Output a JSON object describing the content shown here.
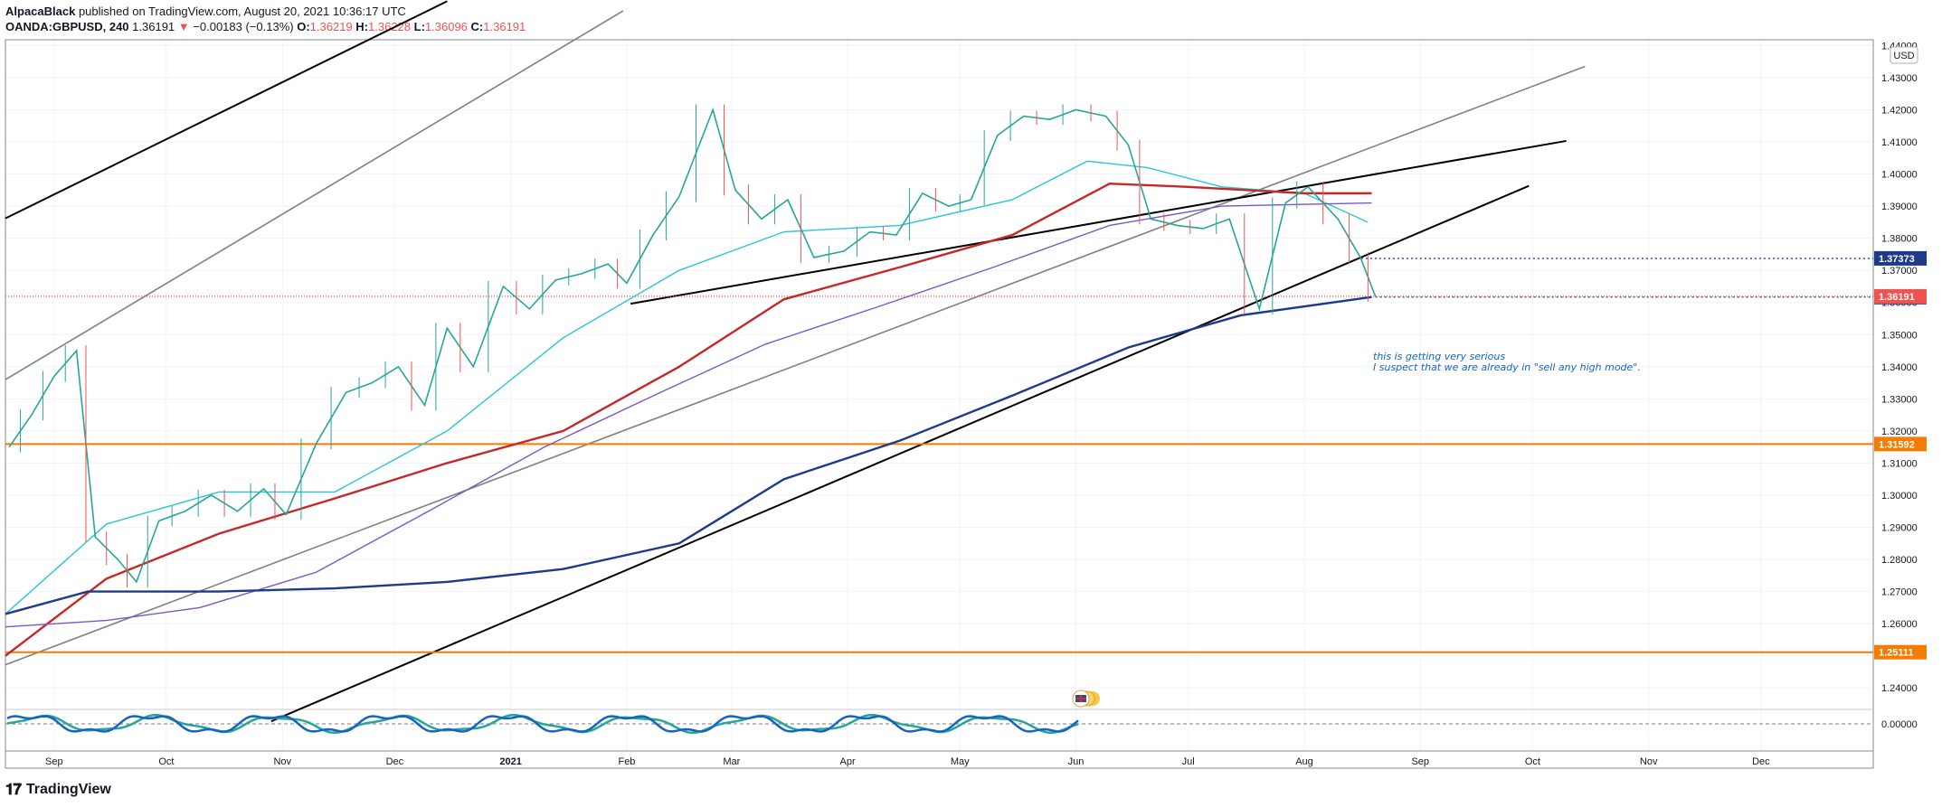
{
  "header": {
    "author": "AlpacaBlack",
    "published_text": "published on TradingView.com, August 20, 2021 10:36:17 UTC",
    "symbol": "OANDA:GBPUSD, 240",
    "last": "1.36191",
    "change_arrow": "▼",
    "change": "−0.00183 (−0.13%)",
    "o_label": "O:",
    "o_value": "1.36219",
    "h_label": "H:",
    "h_value": "1.36228",
    "l_label": "L:",
    "l_value": "1.36096",
    "c_label": "C:",
    "c_value": "1.36191"
  },
  "footer": {
    "brand": "TradingView",
    "logo_icon": "tradingview-logo-icon"
  },
  "chart_data": {
    "type": "line",
    "currency_button": "USD",
    "title": "",
    "xlabel": "",
    "ylabel": "",
    "ylim": [
      1.2333,
      1.4418
    ],
    "grid": true,
    "y_ticks": [
      "1.24000",
      "1.25000",
      "1.26000",
      "1.27000",
      "1.28000",
      "1.29000",
      "1.30000",
      "1.31000",
      "1.32000",
      "1.33000",
      "1.34000",
      "1.35000",
      "1.36000",
      "1.37000",
      "1.38000",
      "1.39000",
      "1.40000",
      "1.41000",
      "1.42000",
      "1.43000",
      "1.44000"
    ],
    "x_ticks": [
      "Sep",
      "Oct",
      "Nov",
      "Dec",
      "2021",
      "Feb",
      "Mar",
      "Apr",
      "May",
      "Jun",
      "Jul",
      "Aug",
      "Sep",
      "Oct",
      "Nov",
      "Dec"
    ],
    "x_bold": [
      "2021"
    ],
    "price_path": {
      "name": "",
      "color": "#26a69a",
      "x": [
        "2020-08-20",
        "2020-08-26",
        "2020-09-01",
        "2020-09-07",
        "2020-09-12",
        "2020-09-18",
        "2020-09-23",
        "2020-09-29",
        "2020-10-06",
        "2020-10-13",
        "2020-10-20",
        "2020-10-27",
        "2020-11-02",
        "2020-11-10",
        "2020-11-18",
        "2020-11-25",
        "2020-12-02",
        "2020-12-09",
        "2020-12-15",
        "2020-12-22",
        "2020-12-30",
        "2021-01-06",
        "2021-01-13",
        "2021-01-20",
        "2021-01-27",
        "2021-02-01",
        "2021-02-08",
        "2021-02-15",
        "2021-02-24",
        "2021-03-02",
        "2021-03-09",
        "2021-03-16",
        "2021-03-23",
        "2021-03-31",
        "2021-04-07",
        "2021-04-14",
        "2021-04-21",
        "2021-04-28",
        "2021-05-04",
        "2021-05-11",
        "2021-05-18",
        "2021-05-25",
        "2021-06-01",
        "2021-06-09",
        "2021-06-15",
        "2021-06-21",
        "2021-06-28",
        "2021-07-05",
        "2021-07-12",
        "2021-07-20",
        "2021-07-27",
        "2021-08-02",
        "2021-08-10",
        "2021-08-16",
        "2021-08-20"
      ],
      "y": [
        1.315,
        1.325,
        1.337,
        1.345,
        1.287,
        1.28,
        1.273,
        1.292,
        1.295,
        1.3,
        1.295,
        1.302,
        1.294,
        1.316,
        1.332,
        1.335,
        1.34,
        1.328,
        1.352,
        1.34,
        1.365,
        1.358,
        1.367,
        1.369,
        1.372,
        1.366,
        1.381,
        1.393,
        1.42,
        1.395,
        1.386,
        1.392,
        1.374,
        1.376,
        1.382,
        1.381,
        1.394,
        1.39,
        1.392,
        1.412,
        1.418,
        1.417,
        1.42,
        1.418,
        1.409,
        1.386,
        1.384,
        1.383,
        1.386,
        1.358,
        1.391,
        1.396,
        1.386,
        1.374,
        1.3619
      ]
    },
    "ma_lines": [
      {
        "name": "",
        "color": "#26c6da",
        "x": [
          "2020-08-19",
          "2020-09-15",
          "2020-10-15",
          "2020-11-15",
          "2020-12-15",
          "2021-01-15",
          "2021-02-15",
          "2021-03-15",
          "2021-04-15",
          "2021-05-15",
          "2021-06-04",
          "2021-06-20",
          "2021-07-10",
          "2021-08-01",
          "2021-08-18"
        ],
        "y": [
          1.263,
          1.291,
          1.301,
          1.301,
          1.32,
          1.349,
          1.37,
          1.382,
          1.384,
          1.392,
          1.404,
          1.402,
          1.396,
          1.394,
          1.385
        ]
      },
      {
        "name": "",
        "color": "#c62828",
        "x": [
          "2020-08-19",
          "2020-09-15",
          "2020-10-15",
          "2020-11-15",
          "2020-12-15",
          "2021-01-15",
          "2021-02-15",
          "2021-03-15",
          "2021-04-15",
          "2021-05-15",
          "2021-06-10",
          "2021-07-01",
          "2021-08-01",
          "2021-08-19"
        ],
        "y": [
          1.25,
          1.274,
          1.288,
          1.299,
          1.31,
          1.32,
          1.34,
          1.361,
          1.371,
          1.381,
          1.397,
          1.396,
          1.394,
          1.394
        ]
      },
      {
        "name": "",
        "color": "#7e57c2",
        "x": [
          "2020-08-19",
          "2020-09-15",
          "2020-10-10",
          "2020-11-10",
          "2020-12-10",
          "2021-01-10",
          "2021-02-10",
          "2021-03-10",
          "2021-04-10",
          "2021-05-10",
          "2021-06-10",
          "2021-07-10",
          "2021-08-19"
        ],
        "y": [
          1.259,
          1.261,
          1.265,
          1.276,
          1.295,
          1.315,
          1.332,
          1.347,
          1.359,
          1.371,
          1.384,
          1.39,
          1.391
        ]
      },
      {
        "name": "",
        "color": "#1e3a8a",
        "x": [
          "2020-08-19",
          "2020-09-10",
          "2020-10-15",
          "2020-11-15",
          "2020-12-15",
          "2021-01-15",
          "2021-02-15",
          "2021-03-15",
          "2021-04-15",
          "2021-05-15",
          "2021-06-15",
          "2021-07-15",
          "2021-08-19"
        ],
        "y": [
          1.263,
          1.27,
          1.27,
          1.271,
          1.273,
          1.277,
          1.285,
          1.305,
          1.317,
          1.331,
          1.346,
          1.356,
          1.3617
        ]
      }
    ],
    "trend_lines": [
      {
        "color": "#000000",
        "x": [
          "2020-08-19",
          "2020-12-15"
        ],
        "y": [
          1.3862,
          1.4538
        ]
      },
      {
        "color": "#808080",
        "x": [
          "2020-08-19",
          "2021-01-31"
        ],
        "y": [
          1.336,
          1.4508
        ]
      },
      {
        "color": "#808080",
        "x": [
          "2020-08-19",
          "2021-10-15"
        ],
        "y": [
          1.2472,
          1.4335
        ]
      },
      {
        "color": "#000000",
        "x": [
          "2020-10-29",
          "2021-09-30"
        ],
        "y": [
          1.2296,
          1.3963
        ]
      },
      {
        "color": "#000000",
        "x": [
          "2021-02-02",
          "2021-10-10"
        ],
        "y": [
          1.3596,
          1.4103
        ]
      }
    ],
    "levels": [
      {
        "value": 1.31592,
        "label": "1.31592",
        "color": "#f57c00",
        "style": "solid"
      },
      {
        "value": 1.25111,
        "label": "1.25111",
        "color": "#f57c00",
        "style": "solid"
      },
      {
        "value": 1.37373,
        "label": "1.37373",
        "color": "#1e3a8a",
        "style": "dotted",
        "from": "2021-08-15"
      },
      {
        "value": 1.36167,
        "label": "1.36167",
        "color": "#1e3a8a",
        "style": "dotted",
        "from": "2021-08-20"
      },
      {
        "value": 1.36191,
        "label": "1.36191",
        "color": "#ef5350",
        "style": "last"
      }
    ],
    "annotation": {
      "lines": [
        "this is getting very serious",
        "I suspect that we are already in \"sell any high mode\"."
      ],
      "color": "#1565c0"
    },
    "oscillator": {
      "zero_label": "0.00000"
    },
    "event_icons": {
      "name": "uk-flag-icon"
    }
  }
}
